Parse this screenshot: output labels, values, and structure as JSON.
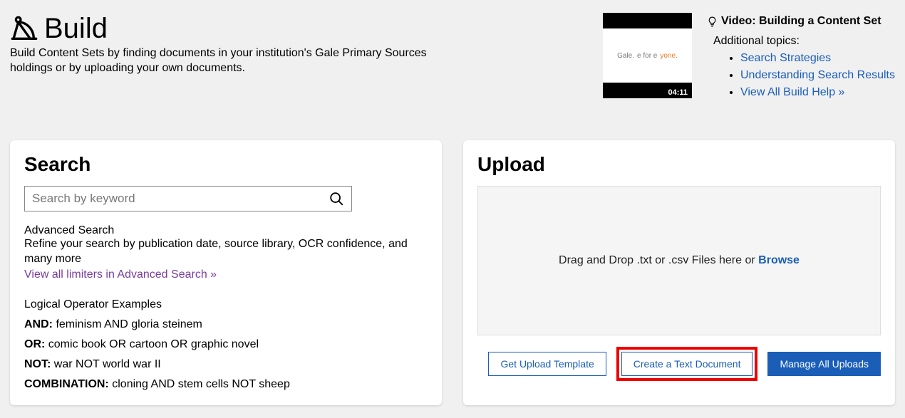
{
  "header": {
    "title": "Build",
    "description": "Build Content Sets by finding documents in your institution's Gale Primary Sources holdings or by uploading your own documents."
  },
  "help": {
    "thumb_text_left": "Gale.",
    "thumb_text_mid": "e for e",
    "thumb_text_right": "yone.",
    "duration": "04:11",
    "video_title": "Video: Building a Content Set",
    "additional_label": "Additional topics:",
    "links": {
      "l1": "Search Strategies",
      "l2": "Understanding Search Results",
      "l3": "View All Build Help »"
    }
  },
  "search": {
    "title": "Search",
    "placeholder": "Search by keyword",
    "advanced_title": "Advanced Search",
    "advanced_desc": "Refine your search by publication date, source library, OCR confidence, and many more",
    "advanced_link": "View all limiters in Advanced Search »",
    "ops_title": "Logical Operator Examples",
    "ops": {
      "and_label": "AND:",
      "and_ex": "feminism AND gloria steinem",
      "or_label": "OR:",
      "or_ex": "comic book OR cartoon OR graphic novel",
      "not_label": "NOT:",
      "not_ex": "war NOT world war II",
      "combo_label": "COMBINATION:",
      "combo_ex": "cloning AND stem cells NOT sheep"
    }
  },
  "upload": {
    "title": "Upload",
    "drop_text": "Drag and Drop .txt or .csv Files here or ",
    "browse": "Browse",
    "btn_template": "Get Upload Template",
    "btn_create": "Create a Text Document",
    "btn_manage": "Manage All Uploads"
  }
}
